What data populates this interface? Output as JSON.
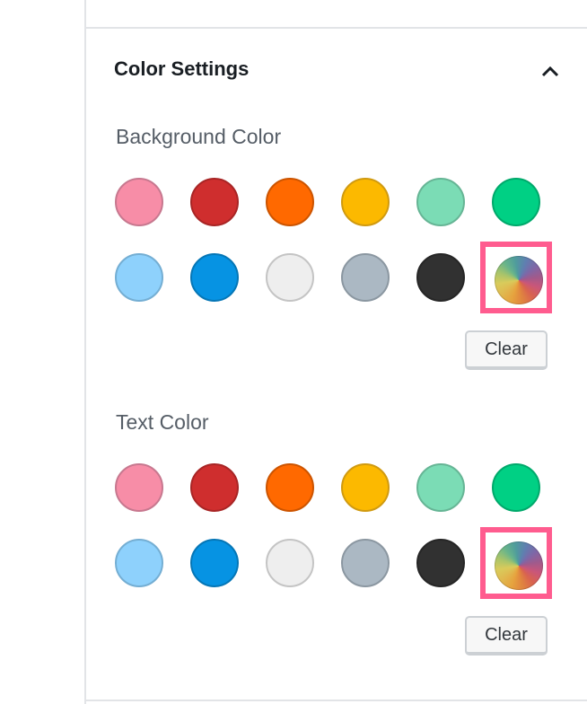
{
  "panel": {
    "title": "Color Settings",
    "expanded": true,
    "toggle_icon": "chevron-up-icon"
  },
  "sections": [
    {
      "label": "Background Color",
      "swatches": [
        {
          "name": "pale-pink",
          "color": "#f78da7",
          "border": "#c7788f"
        },
        {
          "name": "vivid-red",
          "color": "#cf2e2e",
          "border": "#a82525"
        },
        {
          "name": "luminous-vivid-orange",
          "color": "#ff6900",
          "border": "#cc5400"
        },
        {
          "name": "luminous-vivid-amber",
          "color": "#fcb900",
          "border": "#d09a10"
        },
        {
          "name": "light-green-cyan",
          "color": "#7bdcb5",
          "border": "#66b595"
        },
        {
          "name": "vivid-green-cyan",
          "color": "#00d084",
          "border": "#00a96b"
        },
        {
          "name": "pale-cyan-blue",
          "color": "#8ed1fc",
          "border": "#74aed3"
        },
        {
          "name": "vivid-cyan-blue",
          "color": "#0693e3",
          "border": "#0576b6"
        },
        {
          "name": "very-light-gray",
          "color": "#eeeeee",
          "border": "#c4c4c4"
        },
        {
          "name": "cyan-bluish-gray",
          "color": "#abb8c3",
          "border": "#8b97a1"
        },
        {
          "name": "very-dark-gray",
          "color": "#313131",
          "border": "#262626"
        }
      ],
      "custom_color_icon": "color-wheel-icon",
      "clear_label": "Clear"
    },
    {
      "label": "Text Color",
      "swatches": [
        {
          "name": "pale-pink",
          "color": "#f78da7",
          "border": "#c7788f"
        },
        {
          "name": "vivid-red",
          "color": "#cf2e2e",
          "border": "#a82525"
        },
        {
          "name": "luminous-vivid-orange",
          "color": "#ff6900",
          "border": "#cc5400"
        },
        {
          "name": "luminous-vivid-amber",
          "color": "#fcb900",
          "border": "#d09a10"
        },
        {
          "name": "light-green-cyan",
          "color": "#7bdcb5",
          "border": "#66b595"
        },
        {
          "name": "vivid-green-cyan",
          "color": "#00d084",
          "border": "#00a96b"
        },
        {
          "name": "pale-cyan-blue",
          "color": "#8ed1fc",
          "border": "#74aed3"
        },
        {
          "name": "vivid-cyan-blue",
          "color": "#0693e3",
          "border": "#0576b6"
        },
        {
          "name": "very-light-gray",
          "color": "#eeeeee",
          "border": "#c4c4c4"
        },
        {
          "name": "cyan-bluish-gray",
          "color": "#abb8c3",
          "border": "#8b97a1"
        },
        {
          "name": "very-dark-gray",
          "color": "#313131",
          "border": "#262626"
        }
      ],
      "custom_color_icon": "color-wheel-icon",
      "clear_label": "Clear"
    }
  ],
  "highlight_color": "#ff5c8f"
}
